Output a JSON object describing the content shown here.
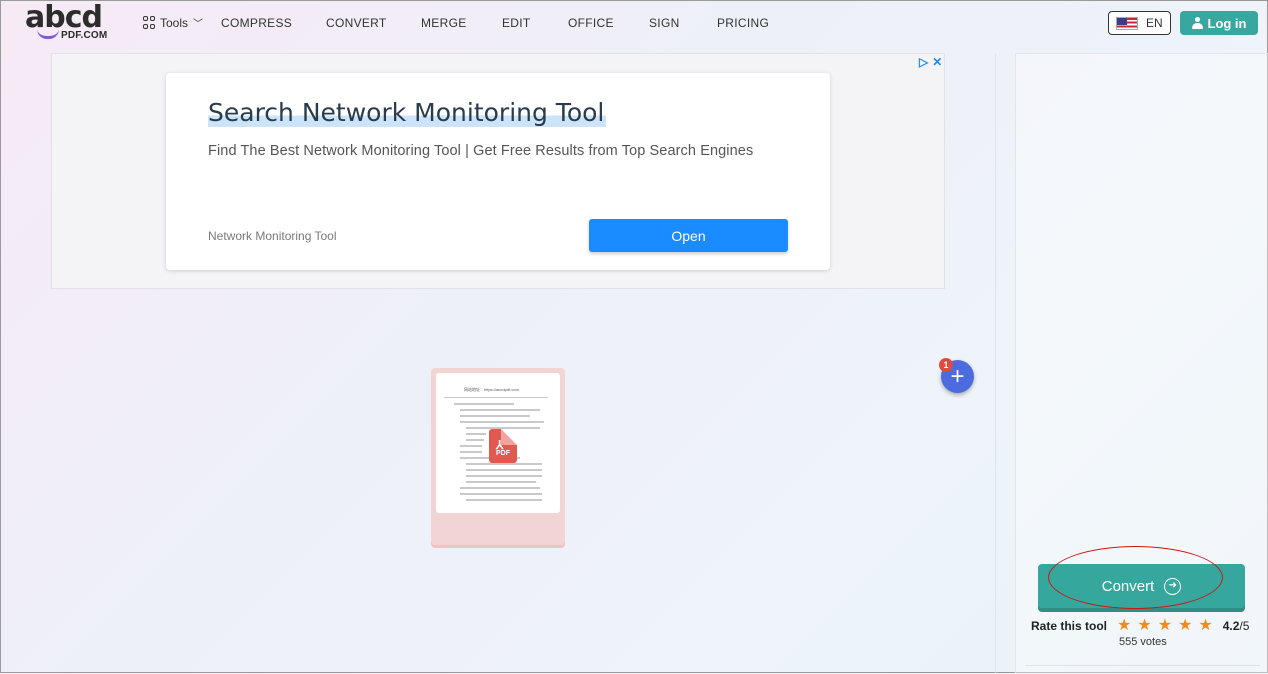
{
  "brand": {
    "logo_main": "abcd",
    "logo_sub": "PDF.COM"
  },
  "nav": {
    "tools_label": "Tools",
    "links": [
      "COMPRESS",
      "CONVERT",
      "MERGE",
      "EDIT",
      "OFFICE",
      "SIGN",
      "PRICING"
    ],
    "lang_label": "EN",
    "login_label": "Log in"
  },
  "ad": {
    "title": "Search Network Monitoring Tool",
    "description": "Find The Best Network Monitoring Tool | Get Free Results from Top Search Engines",
    "site": "Network Monitoring Tool",
    "open_label": "Open"
  },
  "file": {
    "badge_text": "PDF",
    "doc_header": "网站地址：https://abcdpdf.com",
    "add_count": "1"
  },
  "sidebar": {
    "convert_label": "Convert",
    "rate_label": "Rate this tool",
    "rating_value": "4.2",
    "rating_max": "/5",
    "rating_stars": 5,
    "votes": "555 votes"
  },
  "colors": {
    "accent": "#36a79c",
    "login": "#38a7a0",
    "ad_button": "#1a8cff",
    "add_button": "#4b6bde",
    "annotation": "#d0141a",
    "star": "#f28b1c"
  }
}
